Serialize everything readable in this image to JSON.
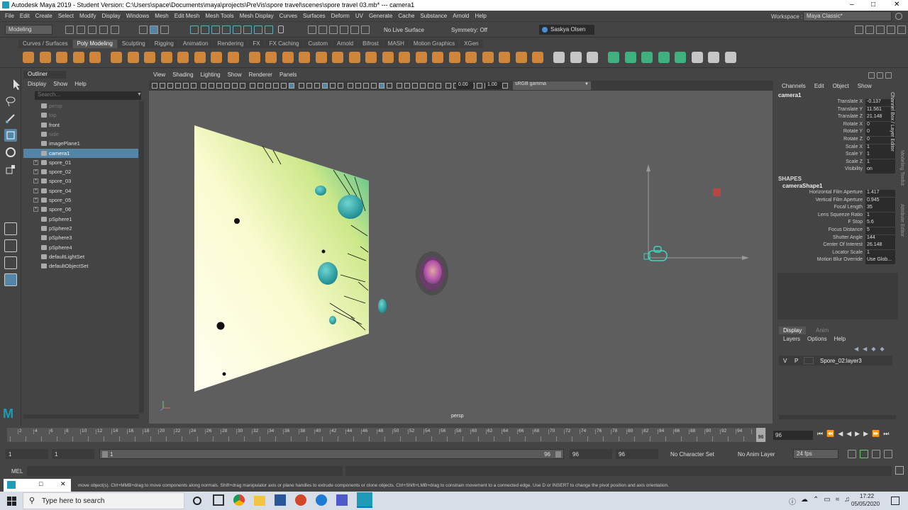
{
  "window": {
    "title": "Autodesk Maya 2019 - Student Version: C:\\Users\\space\\Documents\\maya\\projects\\PreVis\\spore travel\\scenes\\spore travel 03.mb*  ---  camera1"
  },
  "menubar": {
    "items": [
      "File",
      "Edit",
      "Create",
      "Select",
      "Modify",
      "Display",
      "Windows",
      "Mesh",
      "Edit Mesh",
      "Mesh Tools",
      "Mesh Display",
      "Curves",
      "Surfaces",
      "Deform",
      "UV",
      "Generate",
      "Cache",
      "Substance",
      "Arnold",
      "Help"
    ],
    "workspace_label": "Workspace :",
    "workspace_value": "Maya Classic*"
  },
  "statusline": {
    "mode": "Modeling",
    "live_surface": "No Live Surface",
    "symmetry": "Symmetry: Off",
    "user": "Saskya Olsen"
  },
  "shelf": {
    "tabs": [
      "Curves / Surfaces",
      "Poly Modeling",
      "Sculpting",
      "Rigging",
      "Animation",
      "Rendering",
      "FX",
      "FX Caching",
      "Custom",
      "Arnold",
      "Bifrost",
      "MASH",
      "Motion Graphics",
      "XGen"
    ],
    "active": "Poly Modeling"
  },
  "outliner": {
    "title": "Outliner",
    "menu": [
      "Display",
      "Show",
      "Help"
    ],
    "search_placeholder": "Search...",
    "items": [
      {
        "label": "persp",
        "dim": true,
        "exp": false
      },
      {
        "label": "top",
        "dim": true,
        "exp": false
      },
      {
        "label": "front",
        "dim": false,
        "exp": false
      },
      {
        "label": "side",
        "dim": true,
        "exp": false
      },
      {
        "label": "imagePlane1",
        "dim": false,
        "exp": false
      },
      {
        "label": "camera1",
        "dim": false,
        "exp": false,
        "selected": true
      },
      {
        "label": "spore_01",
        "dim": false,
        "exp": true
      },
      {
        "label": "spore_02",
        "dim": false,
        "exp": true
      },
      {
        "label": "spore_03",
        "dim": false,
        "exp": true
      },
      {
        "label": "spore_04",
        "dim": false,
        "exp": true
      },
      {
        "label": "spore_05",
        "dim": false,
        "exp": true
      },
      {
        "label": "spore_06",
        "dim": false,
        "exp": true
      },
      {
        "label": "pSphere1",
        "dim": false,
        "exp": false
      },
      {
        "label": "pSphere2",
        "dim": false,
        "exp": false
      },
      {
        "label": "pSphere3",
        "dim": false,
        "exp": false
      },
      {
        "label": "pSphere4",
        "dim": false,
        "exp": false
      },
      {
        "label": "defaultLightSet",
        "dim": false,
        "exp": false
      },
      {
        "label": "defaultObjectSet",
        "dim": false,
        "exp": false
      }
    ]
  },
  "viewport": {
    "menu": [
      "View",
      "Shading",
      "Lighting",
      "Show",
      "Renderer",
      "Panels"
    ],
    "exposure": "0.00",
    "gamma": "1.00",
    "color_space": "sRGB gamma",
    "camera_label": "persp"
  },
  "channelbox": {
    "menu": [
      "Channels",
      "Edit",
      "Object",
      "Show"
    ],
    "object": "camera1",
    "attrs": [
      {
        "k": "Translate X",
        "v": "-0.137"
      },
      {
        "k": "Translate Y",
        "v": "11.561"
      },
      {
        "k": "Translate Z",
        "v": "21.148"
      },
      {
        "k": "Rotate X",
        "v": "0"
      },
      {
        "k": "Rotate Y",
        "v": "0"
      },
      {
        "k": "Rotate Z",
        "v": "0"
      },
      {
        "k": "Scale X",
        "v": "1"
      },
      {
        "k": "Scale Y",
        "v": "1"
      },
      {
        "k": "Scale Z",
        "v": "1"
      },
      {
        "k": "Visibility",
        "v": "on"
      }
    ],
    "shapes_label": "SHAPES",
    "shape": "cameraShape1",
    "shape_attrs": [
      {
        "k": "Horizontal Film Aperture",
        "v": "1.417"
      },
      {
        "k": "Vertical Film Aperture",
        "v": "0.945"
      },
      {
        "k": "Focal Length",
        "v": "35"
      },
      {
        "k": "Lens Squeeze Ratio",
        "v": "1"
      },
      {
        "k": "F Stop",
        "v": "5.6"
      },
      {
        "k": "Focus Distance",
        "v": "5"
      },
      {
        "k": "Shutter Angle",
        "v": "144"
      },
      {
        "k": "Center Of Interest",
        "v": "26.148"
      },
      {
        "k": "Locator Scale",
        "v": "1"
      },
      {
        "k": "Motion Blur Override",
        "v": "Use Glob..."
      }
    ]
  },
  "sidetabs": {
    "a": "Channel Box / Layer Editor",
    "b": "Modeling Toolkit",
    "c": "Attribute Editor"
  },
  "layers": {
    "tabs": [
      "Display",
      "Anim"
    ],
    "menu": [
      "Layers",
      "Options",
      "Help"
    ],
    "row": {
      "v": "V",
      "p": "P",
      "name": "Spore_02:layer3"
    }
  },
  "timeline": {
    "ticks": [
      "2",
      "4",
      "6",
      "8",
      "10",
      "12",
      "14",
      "16",
      "18",
      "20",
      "22",
      "24",
      "26",
      "28",
      "30",
      "32",
      "34",
      "36",
      "38",
      "40",
      "42",
      "44",
      "46",
      "48",
      "50",
      "52",
      "54",
      "56",
      "58",
      "60",
      "62",
      "64",
      "66",
      "68",
      "70",
      "72",
      "74",
      "76",
      "78",
      "80",
      "82",
      "84",
      "86",
      "88",
      "90",
      "92",
      "94"
    ],
    "current": "96",
    "current_field": "96"
  },
  "range": {
    "start": "1",
    "start2": "1",
    "slider_start": "1",
    "slider_end": "96",
    "end": "96",
    "end2": "96",
    "character_set": "No Character Set",
    "anim_layer": "No Anim Layer",
    "fps": "24 fps"
  },
  "mel": {
    "label": "MEL"
  },
  "helpline": {
    "text": "move object(s). Ctrl+MMB+drag to move components along normals. Shift+drag manipulator axis or plane handles to extrude components or clone objects. Ctrl+Shift+LMB+drag to constrain movement to a connected edge. Use D or INSERT to change the pivot position and axis orientation."
  },
  "taskbar": {
    "search_placeholder": "Type here to search",
    "time": "17:22",
    "date": "05/05/2020"
  }
}
